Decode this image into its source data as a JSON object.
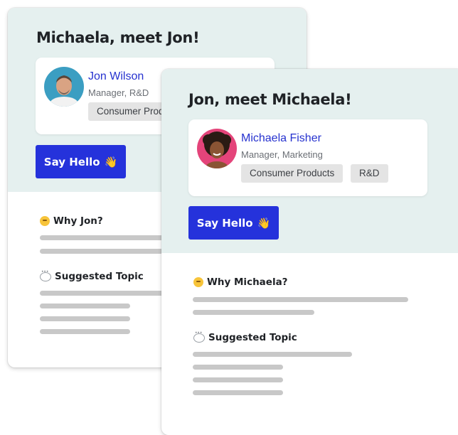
{
  "back_card": {
    "title": "Michaela, meet Jon!",
    "person": {
      "name": "Jon Wilson",
      "role": "Manager, R&D",
      "tags": [
        "Consumer Products"
      ]
    },
    "say_hello": "Say Hello",
    "why_title": "Why Jon?",
    "topic_title": "Suggested Topic"
  },
  "front_card": {
    "title": "Jon, meet Michaela!",
    "person": {
      "name": "Michaela Fisher",
      "role": "Manager, Marketing",
      "tags": [
        "Consumer Products",
        "R&D"
      ]
    },
    "say_hello": "Say Hello",
    "why_title": "Why Michaela?",
    "topic_title": "Suggested Topic"
  },
  "colors": {
    "header_bg": "#e5f0ef",
    "button": "#2532db",
    "name_link": "#2632cf",
    "placeholder_line": "#c8c8c8"
  },
  "icons": [
    "waving-hand-icon",
    "thinking-face-icon",
    "speech-bubble-icon"
  ]
}
